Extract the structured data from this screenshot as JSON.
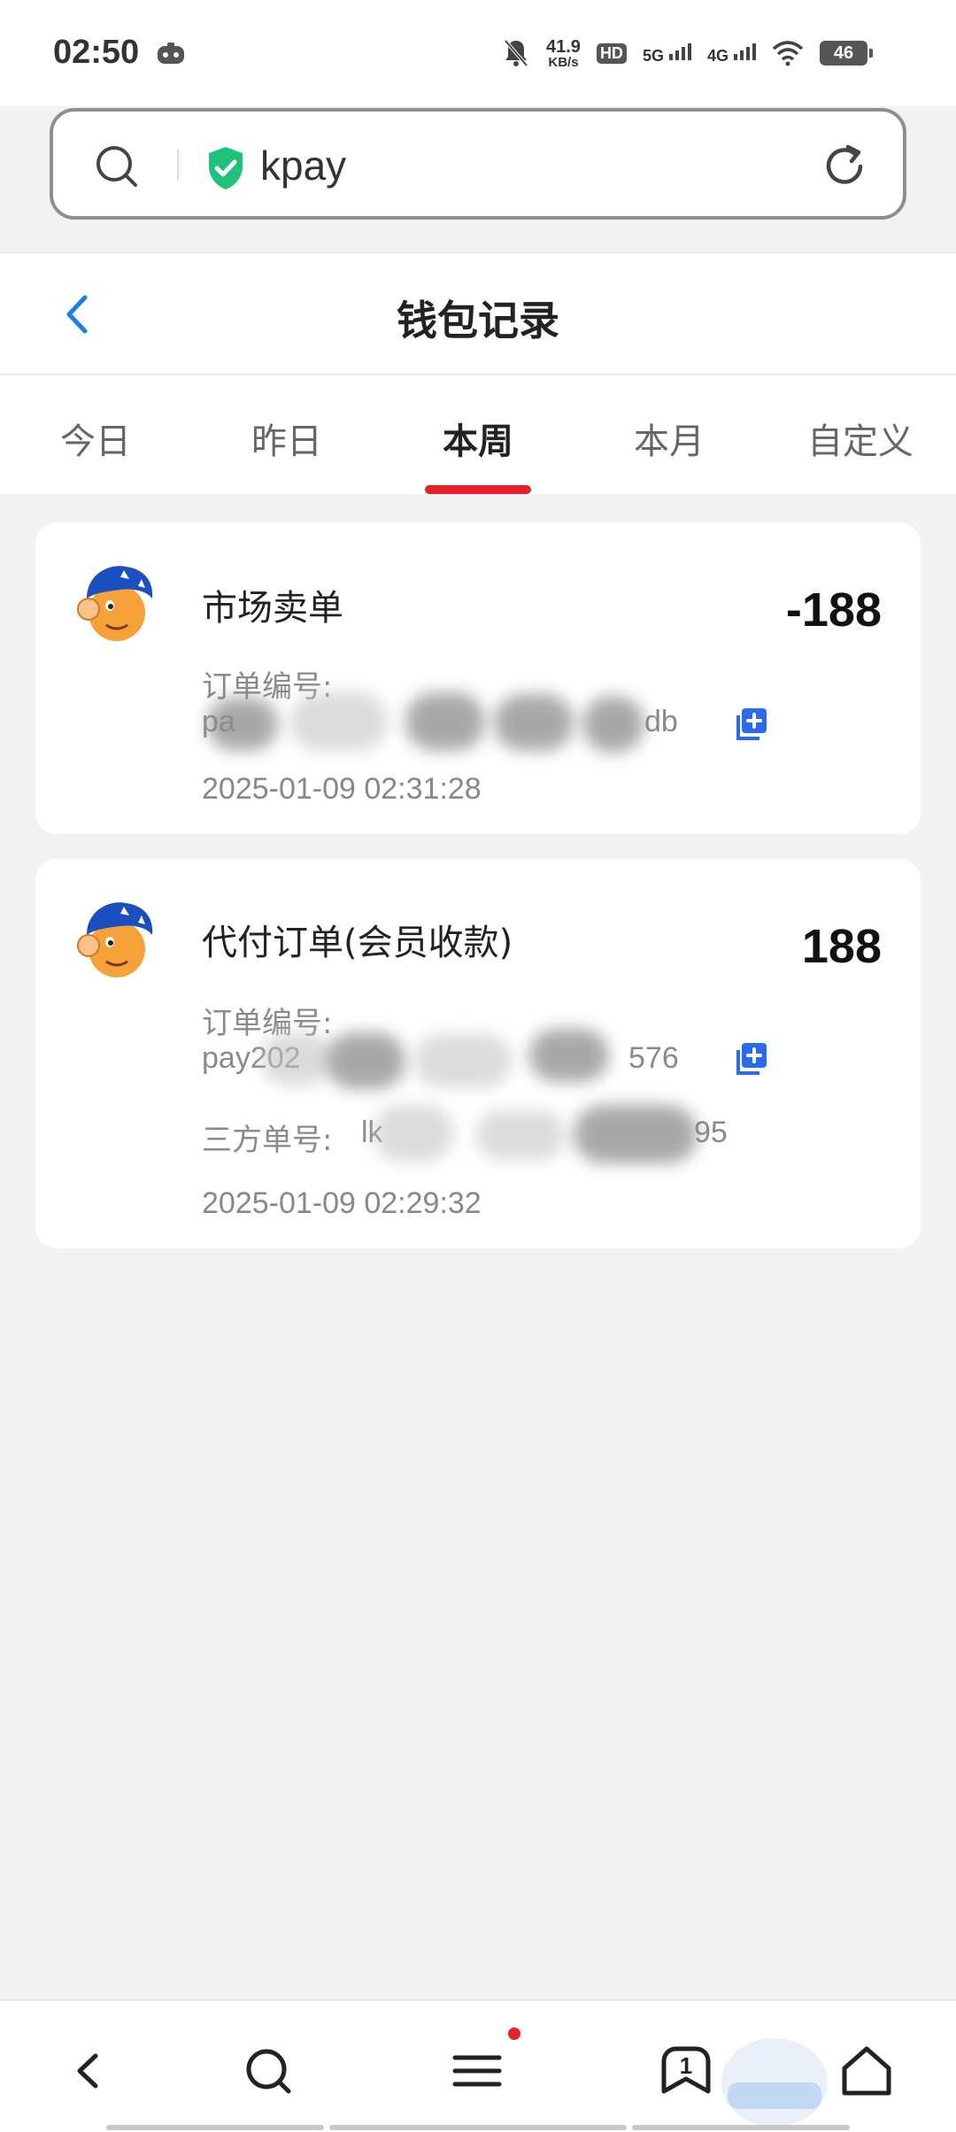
{
  "status_bar": {
    "time": "02:50",
    "net_speed_value": "41.9",
    "net_speed_unit": "KB/s",
    "hd_badge": "HD",
    "sig1": "5G",
    "sig2": "4G",
    "battery": "46",
    "icons": [
      "game-controller-icon",
      "mute-bell-icon",
      "hd-icon",
      "signal-5g-icon",
      "signal-4g-icon",
      "wifi-icon",
      "battery-icon"
    ]
  },
  "browser": {
    "url_text": "kpay",
    "icons": [
      "search-icon",
      "shield-check-icon",
      "refresh-icon"
    ],
    "accent": "#1fc27a"
  },
  "header": {
    "title": "钱包记录"
  },
  "tabs": {
    "items": [
      {
        "label": "今日"
      },
      {
        "label": "昨日"
      },
      {
        "label": "本周"
      },
      {
        "label": "本月"
      },
      {
        "label": "自定义"
      }
    ],
    "active_index": 2,
    "indicator_color": "#e5202c"
  },
  "records": [
    {
      "title": "市场卖单",
      "amount": "-188",
      "order_label": "订单编号:",
      "order_prefix": "pa",
      "order_suffix": "db",
      "time": "2025-01-09 02:31:28"
    },
    {
      "title": "代付订单(会员收款)",
      "amount": "188",
      "order_label": "订单编号:",
      "order_prefix": "pay202",
      "order_suffix": "576",
      "third_label": "三方单号:",
      "third_prefix": "lk",
      "third_suffix": "95",
      "time": "2025-01-09 02:29:32"
    }
  ],
  "bottom_nav": {
    "tab_count": "1",
    "icons": [
      "back-arrow-icon",
      "search-icon",
      "menu-icon",
      "tabs-icon",
      "home-icon"
    ]
  }
}
